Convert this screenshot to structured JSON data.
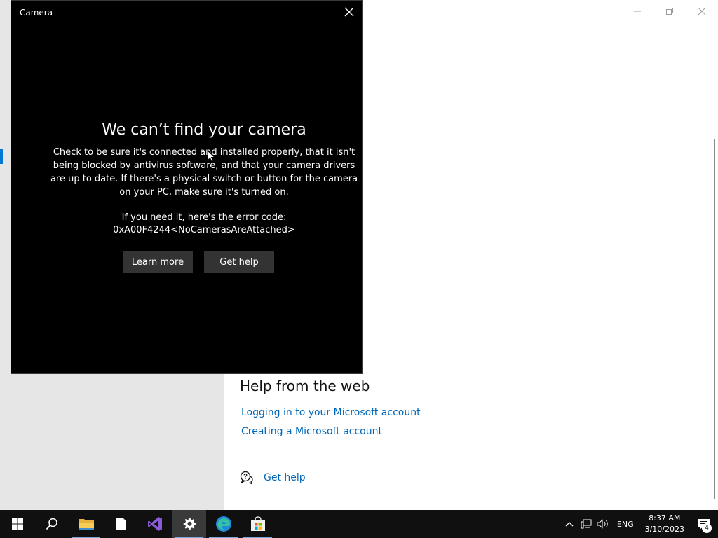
{
  "camera_window": {
    "title": "Camera",
    "heading": "We can’t find your camera",
    "description": "Check to be sure it's connected and installed properly, that it isn't being blocked by antivirus software, and that your camera drivers are up to date. If there's a physical switch or button for the camera on your PC, make sure it's turned on.",
    "error_label": "If you need it, here's the error code:",
    "error_code": "0xA00F4244<NoCamerasAreAttached>",
    "learn_more_label": "Learn more",
    "get_help_label": "Get help"
  },
  "settings": {
    "help_from_web_heading": "Help from the web",
    "links": [
      "Logging in to your Microsoft account",
      "Creating a Microsoft account"
    ],
    "get_help_label": "Get help"
  },
  "taskbar": {
    "apps": [
      "start-icon",
      "search-icon",
      "file-explorer-icon",
      "notepad-icon",
      "visual-studio-icon",
      "settings-icon",
      "edge-icon",
      "store-icon"
    ],
    "active_app": "settings-icon",
    "language": "ENG",
    "time": "8:37 AM",
    "date": "3/10/2023",
    "notification_count": "4"
  },
  "colors": {
    "link": "#0067b8",
    "camera_bg": "#000000",
    "button_bg": "#333333",
    "taskbar_bg": "#101010",
    "accent": "#0078d4"
  }
}
